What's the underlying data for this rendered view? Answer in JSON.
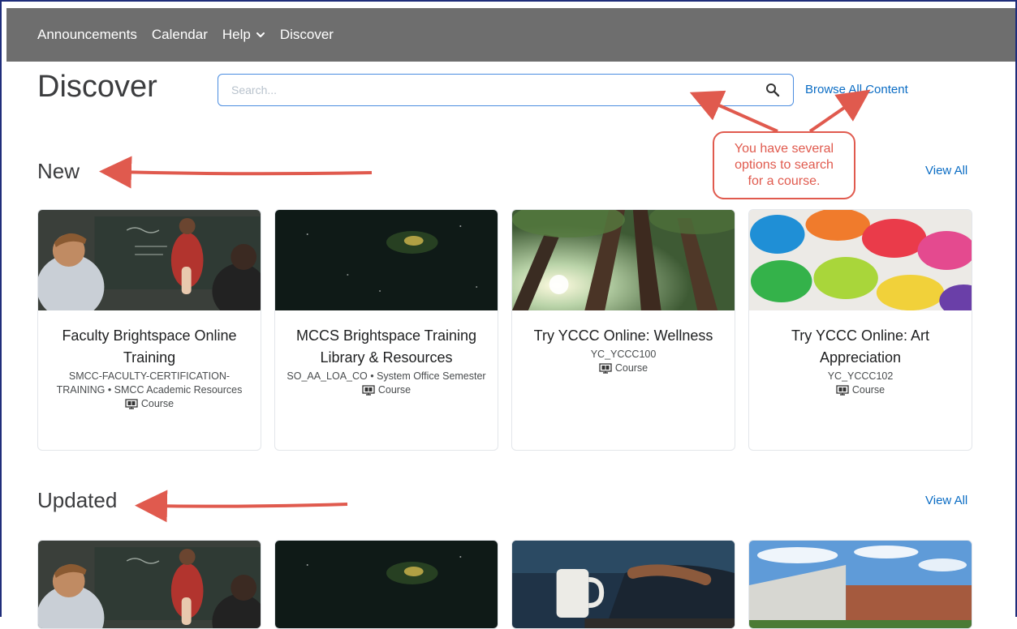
{
  "nav": {
    "items": [
      {
        "label": "Announcements"
      },
      {
        "label": "Calendar"
      },
      {
        "label": "Help",
        "dropdown": true
      },
      {
        "label": "Discover"
      }
    ]
  },
  "header": {
    "title": "Discover",
    "search_placeholder": "Search...",
    "browse_label": "Browse All Content"
  },
  "annotation": {
    "text": "You have several options to search for a course.",
    "color": "#e05a4e"
  },
  "sections": {
    "new": {
      "title": "New",
      "view_all": "View All",
      "cards": [
        {
          "title": "Faculty Brightspace Online Training",
          "meta": "SMCC-FACULTY-CERTIFICATION-TRAINING • SMCC Academic Resources",
          "type": "Course",
          "image": "classroom-photo"
        },
        {
          "title": "MCCS Brightspace Training Library & Resources",
          "meta": "SO_AA_LOA_CO • System Office Semester",
          "type": "Course",
          "image": "night-sky-photo"
        },
        {
          "title": "Try YCCC Online: Wellness",
          "meta": "YC_YCCC100",
          "type": "Course",
          "image": "forest-canopy-photo"
        },
        {
          "title": "Try YCCC Online: Art Appreciation",
          "meta": "YC_YCCC102",
          "type": "Course",
          "image": "watercolor-palette-photo"
        }
      ]
    },
    "updated": {
      "title": "Updated",
      "view_all": "View All",
      "cards": [
        {
          "image": "classroom-photo"
        },
        {
          "image": "night-sky-photo"
        },
        {
          "image": "coffee-laptop-photo"
        },
        {
          "image": "campus-building-photo"
        }
      ]
    }
  },
  "colors": {
    "navbar": "#6e6e6e",
    "link": "#0a6cc4",
    "search_border": "#4b8de0",
    "annotation": "#e05a4e"
  }
}
